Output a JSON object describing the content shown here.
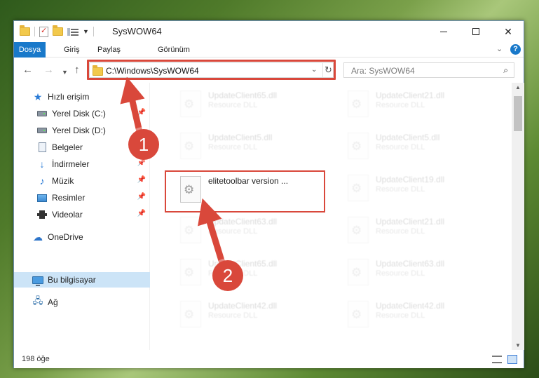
{
  "titlebar": {
    "title": "SysWOW64"
  },
  "ribbon": {
    "file": "Dosya",
    "home": "Giriş",
    "share": "Paylaş",
    "view": "Görünüm"
  },
  "address": {
    "path": "C:\\Windows\\SysWOW64"
  },
  "search": {
    "placeholder": "Ara: SysWOW64"
  },
  "sidebar": {
    "items": [
      {
        "label": "Hızlı erişim"
      },
      {
        "label": "Yerel Disk (C:)"
      },
      {
        "label": "Yerel Disk (D:)"
      },
      {
        "label": "Belgeler"
      },
      {
        "label": "İndirmeler"
      },
      {
        "label": "Müzik"
      },
      {
        "label": "Resimler"
      },
      {
        "label": "Videolar"
      },
      {
        "label": "OneDrive"
      },
      {
        "label": "Bu bilgisayar"
      },
      {
        "label": "Ağ"
      }
    ]
  },
  "files": [
    {
      "name": "UpdateClient65.dll",
      "type": "Resource DLL"
    },
    {
      "name": "UpdateClient21.dll",
      "type": "Resource DLL"
    },
    {
      "name": "UpdateClient5.dll",
      "type": "Resource DLL"
    },
    {
      "name": "UpdateClient5.dll",
      "type": "Resource DLL"
    },
    {
      "name": "elitetoolbar version ...",
      "type": ""
    },
    {
      "name": "UpdateClient19.dll",
      "type": "Resource DLL"
    },
    {
      "name": "UpdateClient63.dll",
      "type": "Resource DLL"
    },
    {
      "name": "UpdateClient21.dll",
      "type": "Resource DLL"
    },
    {
      "name": "UpdateClient65.dll",
      "type": "Resource DLL"
    },
    {
      "name": "UpdateClient63.dll",
      "type": "Resource DLL"
    },
    {
      "name": "UpdateClient42.dll",
      "type": "Resource DLL"
    },
    {
      "name": "UpdateClient42.dll",
      "type": "Resource DLL"
    }
  ],
  "status": {
    "count": "198 öğe"
  },
  "callouts": {
    "one": "1",
    "two": "2"
  },
  "colors": {
    "accent": "#1979ca",
    "highlight": "#d9483b",
    "selected": "#cce4f7"
  }
}
